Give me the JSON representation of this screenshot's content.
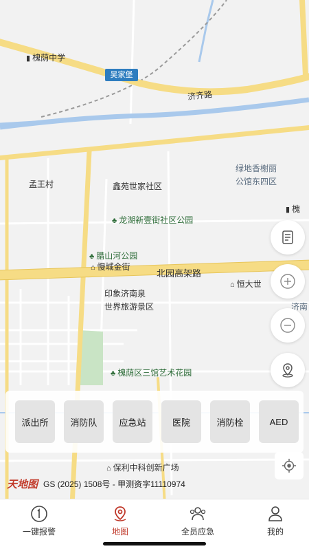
{
  "map": {
    "labels": {
      "school": "槐荫中学",
      "shield": "吴家堡",
      "road_jiqi": "济齐路",
      "lvdi": "绿地香榭丽",
      "lvdi2": "公馆东四区",
      "village": "孟王村",
      "xinyuan": "鑫苑世家社区",
      "park1": "龙湖新壹街社区公园",
      "park2": "腊山河公园",
      "mall": "慢城金街",
      "road_beiyuan": "北园高架路",
      "hengda": "恒大世",
      "yinxiang1": "印象济南泉",
      "yinxiang2": "世界旅游景区",
      "art": "槐荫区三馆艺术花园",
      "baoli": "保利中科创新广场",
      "huai_edge": "槐",
      "ji_edge": "济南"
    }
  },
  "controls": {
    "layers_icon": "document-icon",
    "zoom_in_icon": "plus-icon",
    "zoom_out_icon": "minus-icon",
    "location_pin_icon": "location-icon"
  },
  "panel": {
    "buttons": [
      "派出所",
      "消防队",
      "应急站",
      "医院",
      "消防栓",
      "AED"
    ]
  },
  "attribution": {
    "logo": "天地图",
    "text": "GS (2025) 1508号 - 甲测资字11110974"
  },
  "tabs": [
    {
      "label": "一键报警",
      "icon": "alarm-icon"
    },
    {
      "label": "地图",
      "icon": "map-pin-icon"
    },
    {
      "label": "全员应急",
      "icon": "group-icon"
    },
    {
      "label": "我的",
      "icon": "user-icon"
    }
  ],
  "colors": {
    "accent": "#c0392b",
    "road_major": "#f6dc85",
    "water": "#a9c9ec",
    "park": "#c9e4c5"
  }
}
